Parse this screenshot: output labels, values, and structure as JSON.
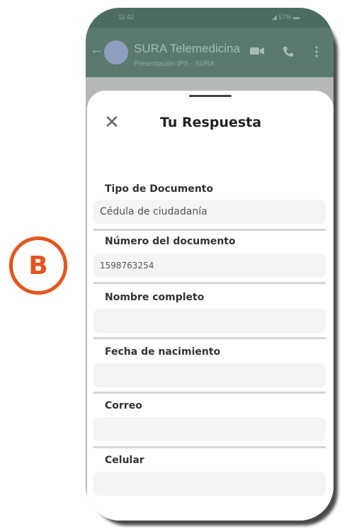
{
  "badge": {
    "letter": "B"
  },
  "status": {
    "time": "11:42",
    "right": "◢ 57% ▬"
  },
  "chat": {
    "back_glyph": "←",
    "title": "SURA Telemedicina",
    "subtitle": "Presentación IPS - SURA",
    "icons": [
      "video-icon",
      "phone-icon",
      "menu-icon"
    ]
  },
  "sheet": {
    "close_glyph": "✕",
    "title": "Tu Respuesta",
    "fields": [
      {
        "label": "Tipo de Documento",
        "value": "Cédula de ciudadanía",
        "placeholder": ""
      },
      {
        "label": "Número del documento",
        "value": "1598763254",
        "placeholder": ""
      },
      {
        "label": "Nombre completo",
        "value": "",
        "placeholder": ""
      },
      {
        "label": "Fecha de nacimiento",
        "value": "",
        "placeholder": ""
      },
      {
        "label": "Correo",
        "value": "",
        "placeholder": ""
      },
      {
        "label": "Celular",
        "value": "",
        "placeholder": ""
      }
    ]
  },
  "colors": {
    "accent": "#e2561f",
    "header": "#5a7a70",
    "field_bg": "#f4f4f4"
  }
}
